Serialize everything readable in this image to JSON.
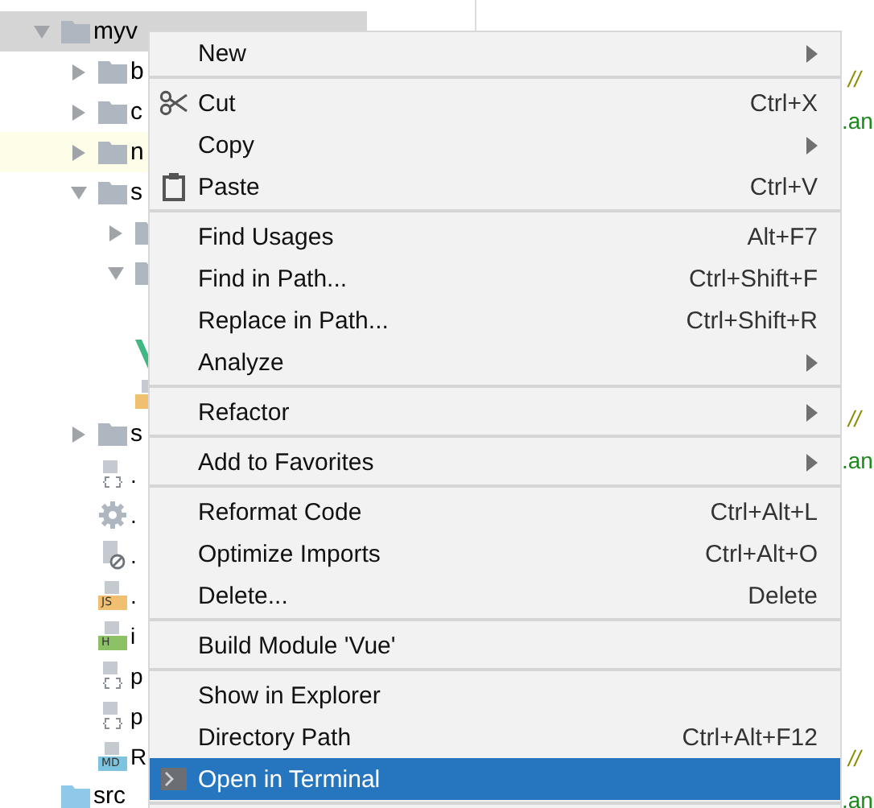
{
  "project_tree": [
    {
      "kind": "folder",
      "label": "myv",
      "expanded": true,
      "selected": true,
      "highlighted": false,
      "children": [
        {
          "kind": "folder",
          "label": "b",
          "expanded": false,
          "selected": false,
          "highlighted": false
        },
        {
          "kind": "folder",
          "label": "c",
          "expanded": false,
          "selected": false,
          "highlighted": false
        },
        {
          "kind": "folder",
          "label": "n",
          "expanded": false,
          "selected": false,
          "highlighted": true
        },
        {
          "kind": "folder",
          "label": "s",
          "expanded": true,
          "selected": false,
          "highlighted": false,
          "children": [
            {
              "kind": "folder",
              "expanded": false,
              "selected": false,
              "highlighted": false
            },
            {
              "kind": "folder",
              "expanded": true,
              "selected": false,
              "highlighted": false
            },
            {
              "kind": "vue",
              "selected": false,
              "highlighted": false
            },
            {
              "kind": "js",
              "selected": false,
              "highlighted": false
            }
          ]
        },
        {
          "kind": "folder",
          "label": "s",
          "expanded": false,
          "selected": false,
          "highlighted": false
        },
        {
          "kind": "json",
          "label": ".",
          "selected": false,
          "highlighted": false
        },
        {
          "kind": "settings",
          "label": ".",
          "selected": false,
          "highlighted": false
        },
        {
          "kind": "ignore",
          "label": ".",
          "selected": false,
          "highlighted": false
        },
        {
          "kind": "js",
          "badge": "JS",
          "label": ".",
          "selected": false,
          "highlighted": false
        },
        {
          "kind": "html",
          "badge": "H",
          "label": "i",
          "selected": false,
          "highlighted": false
        },
        {
          "kind": "json",
          "label": "p",
          "selected": false,
          "highlighted": false
        },
        {
          "kind": "json",
          "label": "p",
          "selected": false,
          "highlighted": false
        },
        {
          "kind": "md",
          "badge": "MD",
          "label": "R",
          "selected": false,
          "highlighted": false
        }
      ]
    },
    {
      "kind": "source-folder",
      "label": "src",
      "selected": false,
      "highlighted": false
    }
  ],
  "editor": {
    "comment_blocks": [
      {
        "comment": "//",
        "code": ".an"
      },
      {
        "comment": "//",
        "code": ".an"
      },
      {
        "comment": "//",
        "code": ".an"
      }
    ]
  },
  "context_menu": {
    "groups": [
      [
        {
          "kind": "item",
          "label": "New",
          "submenu": true,
          "selected": false
        }
      ],
      [
        {
          "kind": "cut",
          "label": "Cut",
          "shortcut": "Ctrl+X",
          "selected": false
        },
        {
          "kind": "item",
          "label": "Copy",
          "submenu": true,
          "selected": false
        },
        {
          "kind": "paste",
          "label": "Paste",
          "shortcut": "Ctrl+V",
          "selected": false
        }
      ],
      [
        {
          "kind": "item",
          "label": "Find Usages",
          "shortcut": "Alt+F7",
          "selected": false
        },
        {
          "kind": "item",
          "label": "Find in Path...",
          "shortcut": "Ctrl+Shift+F",
          "selected": false
        },
        {
          "kind": "item",
          "label": "Replace in Path...",
          "shortcut": "Ctrl+Shift+R",
          "selected": false
        },
        {
          "kind": "item",
          "label": "Analyze",
          "submenu": true,
          "selected": false
        }
      ],
      [
        {
          "kind": "item",
          "label": "Refactor",
          "submenu": true,
          "selected": false
        }
      ],
      [
        {
          "kind": "item",
          "label": "Add to Favorites",
          "submenu": true,
          "selected": false
        }
      ],
      [
        {
          "kind": "item",
          "label": "Reformat Code",
          "shortcut": "Ctrl+Alt+L",
          "selected": false
        },
        {
          "kind": "item",
          "label": "Optimize Imports",
          "shortcut": "Ctrl+Alt+O",
          "selected": false
        },
        {
          "kind": "item",
          "label": "Delete...",
          "shortcut": "Delete",
          "selected": false
        }
      ],
      [
        {
          "kind": "item",
          "label": "Build Module 'Vue'",
          "selected": false
        }
      ],
      [
        {
          "kind": "item",
          "label": "Show in Explorer",
          "selected": false
        },
        {
          "kind": "item",
          "label": "Directory Path",
          "shortcut": "Ctrl+Alt+F12",
          "selected": false
        },
        {
          "kind": "terminal",
          "label": "Open in Terminal",
          "selected": true
        }
      ]
    ]
  }
}
